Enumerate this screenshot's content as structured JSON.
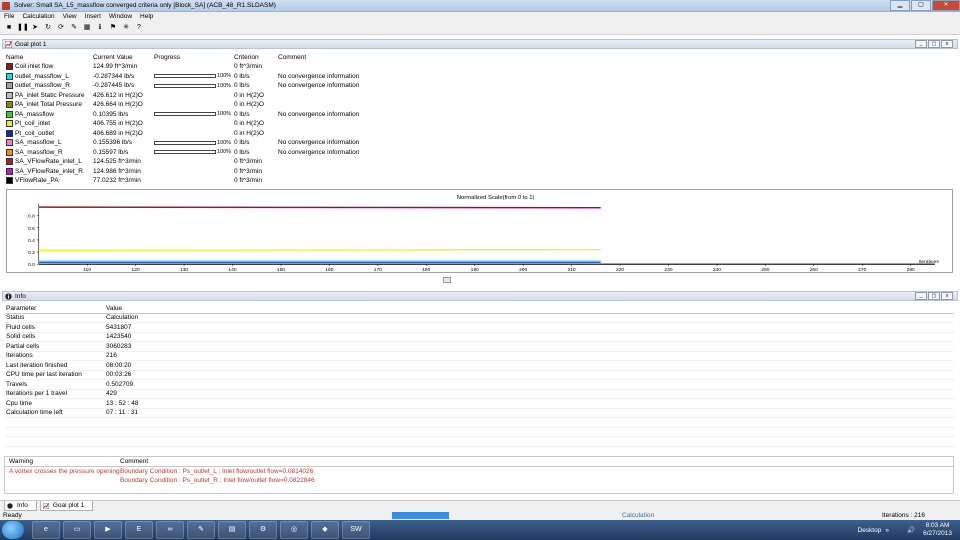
{
  "window": {
    "title": "Solver: Small SA_L5_massflow converged criteria only [Block_SA] (ACB_48_R1.SLDASM)"
  },
  "menu": [
    "File",
    "Calculation",
    "View",
    "Insert",
    "Window",
    "Help"
  ],
  "toolbar": [
    {
      "icon": "stop-icon",
      "glyph": "■"
    },
    {
      "icon": "pause-icon",
      "glyph": "❚❚"
    },
    {
      "icon": "run-icon",
      "glyph": "➤"
    },
    {
      "icon": "refresh-icon",
      "glyph": "↻"
    },
    {
      "icon": "redo-icon",
      "glyph": "⟳"
    },
    {
      "icon": "pin-icon",
      "glyph": "✎"
    },
    {
      "icon": "table-icon",
      "glyph": "▦"
    },
    {
      "icon": "info-icon",
      "glyph": "ℹ"
    },
    {
      "icon": "flag-icon",
      "glyph": "⚑"
    },
    {
      "icon": "chart-icon",
      "glyph": "✳"
    },
    {
      "icon": "goal-icon",
      "glyph": "?"
    }
  ],
  "goal_panel": {
    "title": "Goal plot 1",
    "columns": {
      "name": "Name",
      "value": "Current Value",
      "progress": "Progress",
      "criterion": "Criterion",
      "comment": "Comment"
    },
    "rows": [
      {
        "color": "#8b1a1a",
        "name": "Coil inlet flow",
        "value": "124.99 ft^3/min",
        "progress": null,
        "criterion": "0 ft^3/min",
        "comment": ""
      },
      {
        "color": "#00e5ee",
        "name": "outlet_massflow_L",
        "value": "-0.287344 lb/s",
        "progress": 1.0,
        "pct": "100%",
        "criterion": "0 lb/s",
        "comment": "No convergence information"
      },
      {
        "color": "#a0a0a0",
        "name": "outlet_massflow_R",
        "value": "-0.287445 lb/s",
        "progress": 1.0,
        "pct": "100%",
        "criterion": "0 lb/s",
        "comment": "No convergence information"
      },
      {
        "color": "#bdbdbd",
        "name": "PA_inlet Static Pressure",
        "value": "426.612 in H(2)O",
        "progress": null,
        "criterion": "0 in H(2)O",
        "comment": ""
      },
      {
        "color": "#8b8b00",
        "name": "PA_inlet Total Pressure",
        "value": "426.664 in H(2)O",
        "progress": null,
        "criterion": "0 in H(2)O",
        "comment": ""
      },
      {
        "color": "#33cc33",
        "name": "PA_massflow",
        "value": "0.10395 lb/s",
        "progress": 1.0,
        "pct": "100%",
        "criterion": "0 lb/s",
        "comment": "No convergence information"
      },
      {
        "color": "#f0f000",
        "name": "Pt_coil_inlet",
        "value": "406.755 in H(2)O",
        "progress": null,
        "criterion": "0 in H(2)O",
        "comment": ""
      },
      {
        "color": "#1020e0",
        "name": "Pt_coil_outlet",
        "value": "406.689 in H(2)O",
        "progress": null,
        "criterion": "0 in H(2)O",
        "comment": ""
      },
      {
        "color": "#ff77cc",
        "name": "SA_massflow_L",
        "value": "0.155396 lb/s",
        "progress": 1.0,
        "pct": "100%",
        "criterion": "0 lb/s",
        "comment": "No convergence information"
      },
      {
        "color": "#ff8c00",
        "name": "SA_massflow_R",
        "value": "0.15597 lb/s",
        "progress": 1.0,
        "pct": "100%",
        "criterion": "0 lb/s",
        "comment": "No convergence information"
      },
      {
        "color": "#d01010",
        "name": "SA_VFlowRate_inlet_L",
        "value": "124.525 ft^3/min",
        "progress": null,
        "criterion": "0 ft^3/min",
        "comment": ""
      },
      {
        "color": "#e000e0",
        "name": "SA_VFlowRate_inlet_R",
        "value": "124.986 ft^3/min",
        "progress": null,
        "criterion": "0 ft^3/min",
        "comment": ""
      },
      {
        "color": "#000000",
        "name": "VFlowRate_PA",
        "value": "77.0232 ft^3/min",
        "progress": null,
        "criterion": "0 ft^3/min",
        "comment": ""
      }
    ]
  },
  "chart_data": {
    "type": "line",
    "title": "Normalized Scale(from 0 to 1)",
    "xlabel": "Iterations",
    "ylabel": "",
    "xlim": [
      100,
      285
    ],
    "ylim": [
      0,
      1
    ],
    "xticks": [
      110,
      120,
      130,
      140,
      150,
      160,
      170,
      180,
      190,
      200,
      210,
      220,
      230,
      240,
      250,
      260,
      270,
      280
    ],
    "yticks": [
      0.0,
      0.2,
      0.4,
      0.6,
      0.8
    ],
    "grid": false,
    "series": [
      {
        "color": "#e000e0",
        "x": [
          100,
          216
        ],
        "y": [
          0.94,
          0.93
        ]
      },
      {
        "color": "#8b1a1a",
        "x": [
          100,
          216
        ],
        "y": [
          0.945,
          0.935
        ]
      },
      {
        "color": "#f0f000",
        "x": [
          100,
          216
        ],
        "y": [
          0.23,
          0.24
        ]
      },
      {
        "color": "#00e5ee",
        "x": [
          100,
          216
        ],
        "y": [
          0.05,
          0.05
        ]
      },
      {
        "color": "#1020e0",
        "x": [
          100,
          216
        ],
        "y": [
          0.03,
          0.03
        ]
      },
      {
        "color": "#a0a0a0",
        "x": [
          100,
          216
        ],
        "y": [
          0.04,
          0.04
        ]
      }
    ]
  },
  "info_panel": {
    "title": "Info",
    "columns": {
      "param": "Parameter",
      "value": "Value"
    },
    "rows": [
      {
        "p": "Status",
        "v": "Calculation"
      },
      {
        "p": "Fluid cells",
        "v": "5431807"
      },
      {
        "p": "Solid cells",
        "v": "1423540"
      },
      {
        "p": "Partial cells",
        "v": "3060283"
      },
      {
        "p": "Iterations",
        "v": "216"
      },
      {
        "p": "Last iteration finished",
        "v": "08:00:20"
      },
      {
        "p": "CPU time per last iteration",
        "v": "00:03:26"
      },
      {
        "p": "Travels",
        "v": "0.502709"
      },
      {
        "p": "Iterations per 1 travel",
        "v": "429"
      },
      {
        "p": "Cpu time",
        "v": "13 : 52 : 48"
      },
      {
        "p": "Calculation time left",
        "v": "07 : 11 : 31"
      }
    ]
  },
  "warnings": {
    "columns": {
      "w": "Warning",
      "c": "Comment"
    },
    "rows": [
      {
        "w": "A vortex crosses the pressure opening",
        "c": "Boundary Condition : Ps_outlet_L ; Inlet flow/outlet flow=0.0814026"
      },
      {
        "w": "",
        "c": "Boundary Condition : Ps_outlet_R ; Inlet flow/outlet flow=0.0822846"
      }
    ]
  },
  "bottom_tabs": [
    "Info",
    "Goal plot 1"
  ],
  "status": {
    "ready": "Ready",
    "center": "Calculation",
    "iterations": "Iterations : 216"
  },
  "taskbar": {
    "apps": [
      "ie",
      "folder",
      "media",
      "easy",
      "vs",
      "notepad",
      "doc",
      "tools",
      "target",
      "app1",
      "solidworks"
    ],
    "desktop": "Desktop",
    "time": "8:03 AM",
    "date": "6/27/2013"
  }
}
